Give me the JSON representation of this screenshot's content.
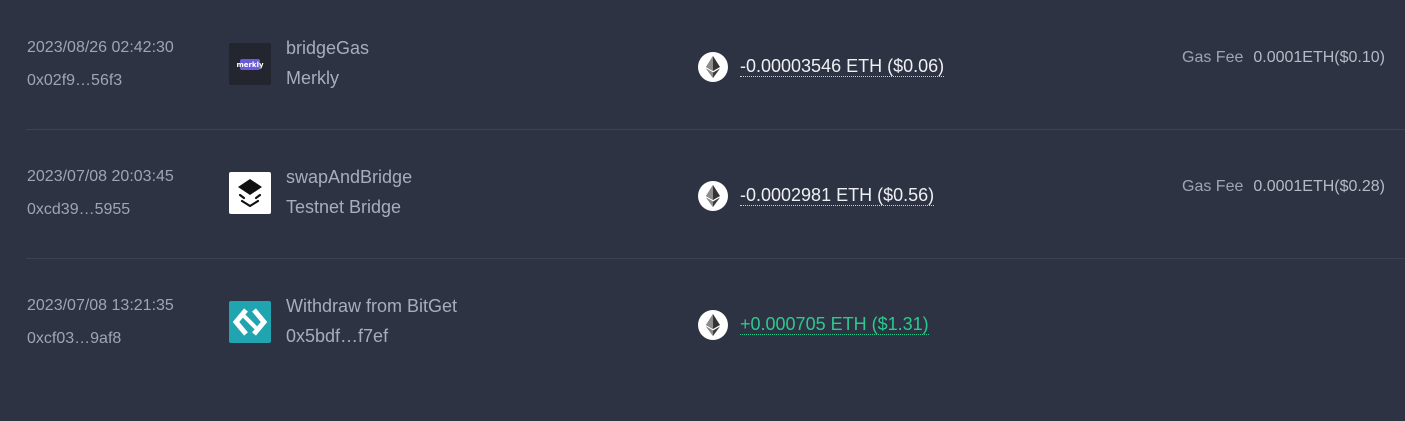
{
  "colors": {
    "background": "#2e3343",
    "divider": "#3c4253",
    "text_primary": "#eef0f4",
    "text_secondary": "#9ea5b4",
    "positive": "#2cc98e",
    "merkly_bg": "#23262e",
    "merkly_accent": "#6a5bd6",
    "bitget_bg": "#1fa4b0"
  },
  "transactions": [
    {
      "time": "2023/08/26 02:42:30",
      "hash": "0x02f9…56f3",
      "method": "bridgeGas",
      "counterparty": "Merkly",
      "logo_icon": "merkly-logo",
      "logo_text": "merkly",
      "token_icon": "ethereum-icon",
      "amount": "-0.00003546 ETH ($0.06)",
      "direction": "out",
      "gas_label": "Gas Fee",
      "gas_value": "0.0001ETH($0.10)"
    },
    {
      "time": "2023/07/08 20:03:45",
      "hash": "0xcd39…5955",
      "method": "swapAndBridge",
      "counterparty": "Testnet Bridge",
      "logo_icon": "testnet-bridge-logo",
      "token_icon": "ethereum-icon",
      "amount": "-0.0002981 ETH ($0.56)",
      "direction": "out",
      "gas_label": "Gas Fee",
      "gas_value": "0.0001ETH($0.28)"
    },
    {
      "time": "2023/07/08 13:21:35",
      "hash": "0xcf03…9af8",
      "method": "Withdraw from BitGet",
      "counterparty": "0x5bdf…f7ef",
      "logo_icon": "bitget-logo",
      "token_icon": "ethereum-icon",
      "amount": "+0.000705 ETH ($1.31)",
      "direction": "in"
    }
  ]
}
